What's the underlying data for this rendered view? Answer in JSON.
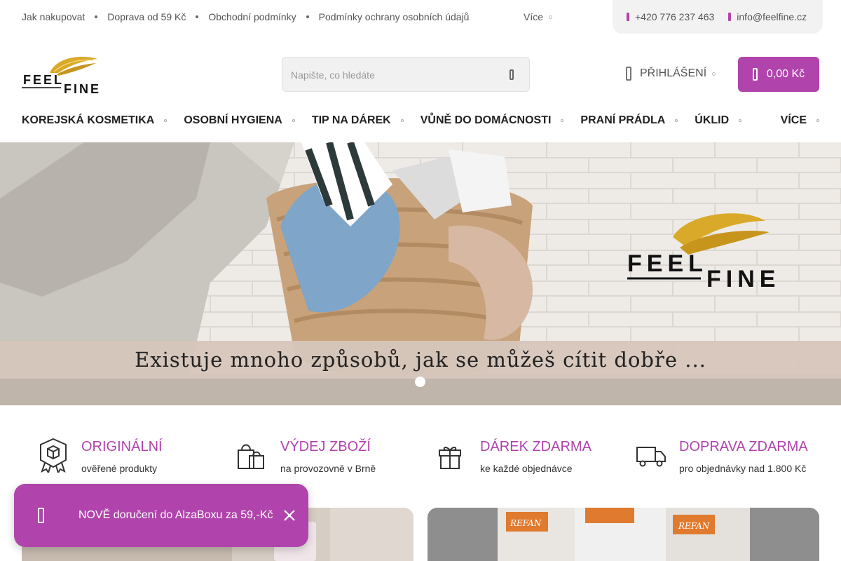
{
  "topbar": {
    "links": [
      "Jak nakupovat",
      "Doprava od 59 Kč",
      "Obchodní podmínky",
      "Podmínky ochrany osobních údajů"
    ],
    "more_label": "Více",
    "phone": "+420 776 237 463",
    "email": "info@feelfine.cz"
  },
  "header": {
    "logo_text_1": "FEEL",
    "logo_text_2": "FINE",
    "search_placeholder": "Napište, co hledáte",
    "login_label": "PŘIHLÁŠENÍ",
    "cart_label": "0,00 Kč"
  },
  "nav": {
    "items": [
      "KOREJSKÁ KOSMETIKA",
      "OSOBNÍ HYGIENA",
      "TIP NA DÁREK",
      "VŮNĚ DO DOMÁCNOSTI",
      "PRANÍ PRÁDLA",
      "ÚKLID"
    ],
    "more_label": "VÍCE"
  },
  "hero": {
    "caption": "Existuje mnoho způsobů, jak se můžeš cítit dobře ...",
    "logo_text_1": "FEEL",
    "logo_text_2": "FINE"
  },
  "benefits": [
    {
      "title": "ORIGINÁLNÍ",
      "subtitle": "ověřené produkty",
      "icon": "badge-icon"
    },
    {
      "title": "VÝDEJ ZBOŽÍ",
      "subtitle": "na provozovně v Brně",
      "icon": "shopping-bags-icon"
    },
    {
      "title": "DÁREK ZDARMA",
      "subtitle": "ke každé objednávce",
      "icon": "gift-icon"
    },
    {
      "title": "DOPRAVA ZDARMA",
      "subtitle": "pro objednávky nad 1.800 Kč",
      "icon": "truck-icon"
    }
  ],
  "products": {
    "brand_label": "REFAN"
  },
  "notification": {
    "text": "NOVĚ doručení do AlzaBoxu za 59,-Kč"
  },
  "colors": {
    "accent": "#b044ac",
    "gold": "#d9a92a"
  }
}
